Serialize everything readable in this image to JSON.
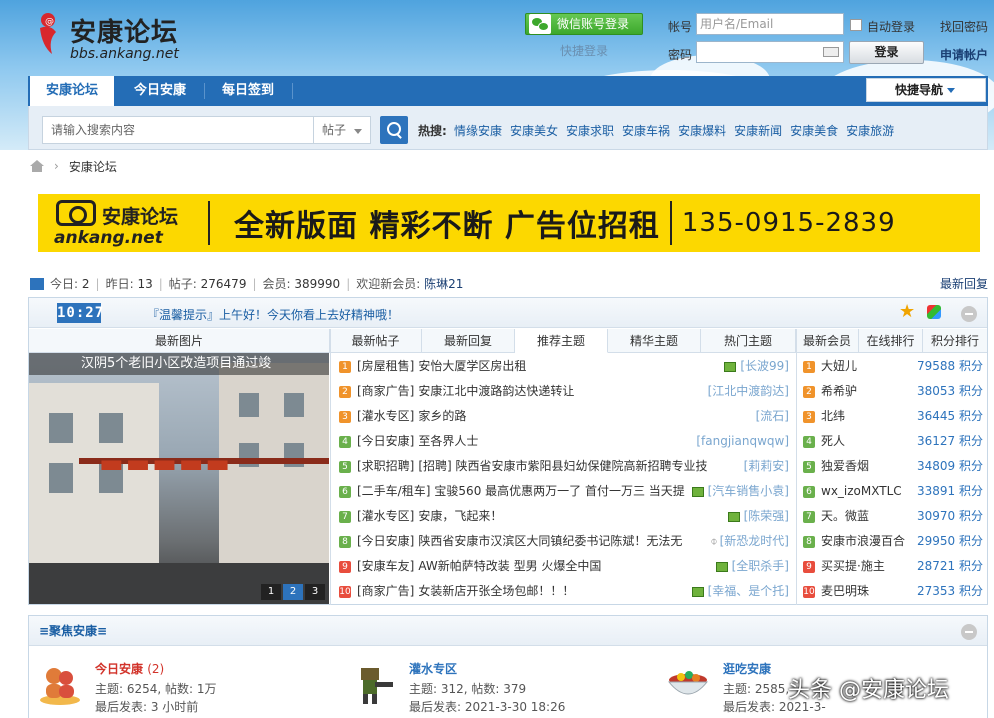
{
  "header": {
    "logo_cn": "安康论坛",
    "logo_en": "bbs.ankang.net",
    "wechat_login": "微信账号登录",
    "quick_login": "快捷登录",
    "account_label": "帐号",
    "account_placeholder": "用户名/Email",
    "auto_login": "自动登录",
    "find_password": "找回密码",
    "password_label": "密码",
    "login_button": "登录",
    "register": "申请帐户"
  },
  "nav": {
    "tabs": [
      {
        "label": "安康论坛",
        "active": true
      },
      {
        "label": "今日安康",
        "active": false
      },
      {
        "label": "每日签到",
        "active": false
      }
    ],
    "quick_nav": "快捷导航"
  },
  "search": {
    "placeholder": "请输入搜索内容",
    "scope": "帖子",
    "hot_label": "热搜:",
    "hot_terms": [
      "情缘安康",
      "安康美女",
      "安康求职",
      "安康车祸",
      "安康爆料",
      "安康新闻",
      "安康美食",
      "安康旅游"
    ]
  },
  "breadcrumb": {
    "current": "安康论坛",
    "separator": "›"
  },
  "banner": {
    "logo_cn": "安康论坛",
    "logo_en": "ankang.net",
    "slogan": "全新版面  精彩不断  广告位招租",
    "phone": "135-0915-2839"
  },
  "stats": {
    "today_label": "今日:",
    "today": "2",
    "yesterday_label": "昨日:",
    "yesterday": "13",
    "posts_label": "帖子:",
    "posts": "276479",
    "members_label": "会员:",
    "members": "389990",
    "welcome_label": "欢迎新会员:",
    "new_member": "陈琳21",
    "latest_reply": "最新回复"
  },
  "panel": {
    "clock": "10:27",
    "notice": "『温馨提示』上午好！今天你看上去好精神哦！",
    "columns": [
      "最新图片",
      "最新帖子",
      "最新回复",
      "推荐主题",
      "精华主题",
      "热门主题",
      "最新会员",
      "在线排行",
      "积分排行"
    ],
    "photo_caption": "汉阴5个老旧小区改造项目通过竣",
    "pager": [
      "1",
      "2",
      "3"
    ],
    "threads": [
      {
        "n": "1",
        "cat": "[房屋租售]",
        "title": "安怡大厦学区房出租",
        "author": "[长波99]",
        "pic": true,
        "clip": false
      },
      {
        "n": "2",
        "cat": "[商家广告]",
        "title": "安康江北中渡路韵达快递转让",
        "author": "[江北中渡韵达]",
        "pic": false,
        "clip": false
      },
      {
        "n": "3",
        "cat": "[灌水专区]",
        "title": "家乡的路",
        "author": "[流石]",
        "pic": false,
        "clip": false
      },
      {
        "n": "4",
        "cat": "[今日安康]",
        "title": "至各界人士",
        "author": "[fangjianqwqw]",
        "pic": false,
        "clip": false
      },
      {
        "n": "5",
        "cat": "[求职招聘]",
        "title": "[招聘] 陕西省安康市紫阳县妇幼保健院高新招聘专业技",
        "author": "[莉莉安]",
        "pic": false,
        "clip": false
      },
      {
        "n": "6",
        "cat": "[二手车/租车]",
        "title": "宝骏560 最高优惠两万一了 首付一万三 当天提",
        "author": "[汽车销售小袁]",
        "pic": true,
        "clip": false
      },
      {
        "n": "7",
        "cat": "[灌水专区]",
        "title": "安康，飞起来！",
        "author": "[陈荣强]",
        "pic": true,
        "clip": false
      },
      {
        "n": "8",
        "cat": "[今日安康]",
        "title": "陕西省安康市汉滨区大同镇纪委书记陈斌！无法无",
        "author": "[新恐龙时代]",
        "pic": false,
        "clip": true
      },
      {
        "n": "9",
        "cat": "[安康车友]",
        "title": "AW新帕萨特改装 型男 火爆全中国",
        "author": "[全职杀手]",
        "pic": true,
        "clip": false
      },
      {
        "n": "10",
        "cat": "[商家广告]",
        "title": "女装新店开张全场包邮！！！",
        "author": "[幸福、是个托]",
        "pic": true,
        "clip": false
      }
    ],
    "members": [
      {
        "n": "1",
        "name": "大妞儿",
        "score": "79588 积分"
      },
      {
        "n": "2",
        "name": "希希驴",
        "score": "38053 积分"
      },
      {
        "n": "3",
        "name": "北纬",
        "score": "36445 积分"
      },
      {
        "n": "4",
        "name": "死人",
        "score": "36127 积分"
      },
      {
        "n": "5",
        "name": "独爱香烟",
        "score": "34809 积分"
      },
      {
        "n": "6",
        "name": "wx_izoMXTLC",
        "score": "33891 积分"
      },
      {
        "n": "7",
        "name": "天。微蓝",
        "score": "30970 积分"
      },
      {
        "n": "8",
        "name": "安康市浪漫百合",
        "score": "29950 积分"
      },
      {
        "n": "9",
        "name": "买买提·施主",
        "score": "28721 积分"
      },
      {
        "n": "10",
        "name": "麦巴明珠",
        "score": "27353 积分"
      }
    ]
  },
  "focus": {
    "title": "≡聚焦安康≡",
    "forums": [
      {
        "name": "今日安康",
        "today": "(2)",
        "line1": "主题: 6254, 帖数: 1万",
        "line2": "最后发表: 3 小时前"
      },
      {
        "name": "灌水专区",
        "today": "",
        "line1": "主题: 312, 帖数: 379",
        "line2": "最后发表: 2021-3-30 18:26"
      },
      {
        "name": "逛吃安康",
        "today": "",
        "line1": "主题: 2585,",
        "line2": "最后发表: 2021-3-"
      }
    ],
    "watermark": "头条 @安康论坛"
  }
}
